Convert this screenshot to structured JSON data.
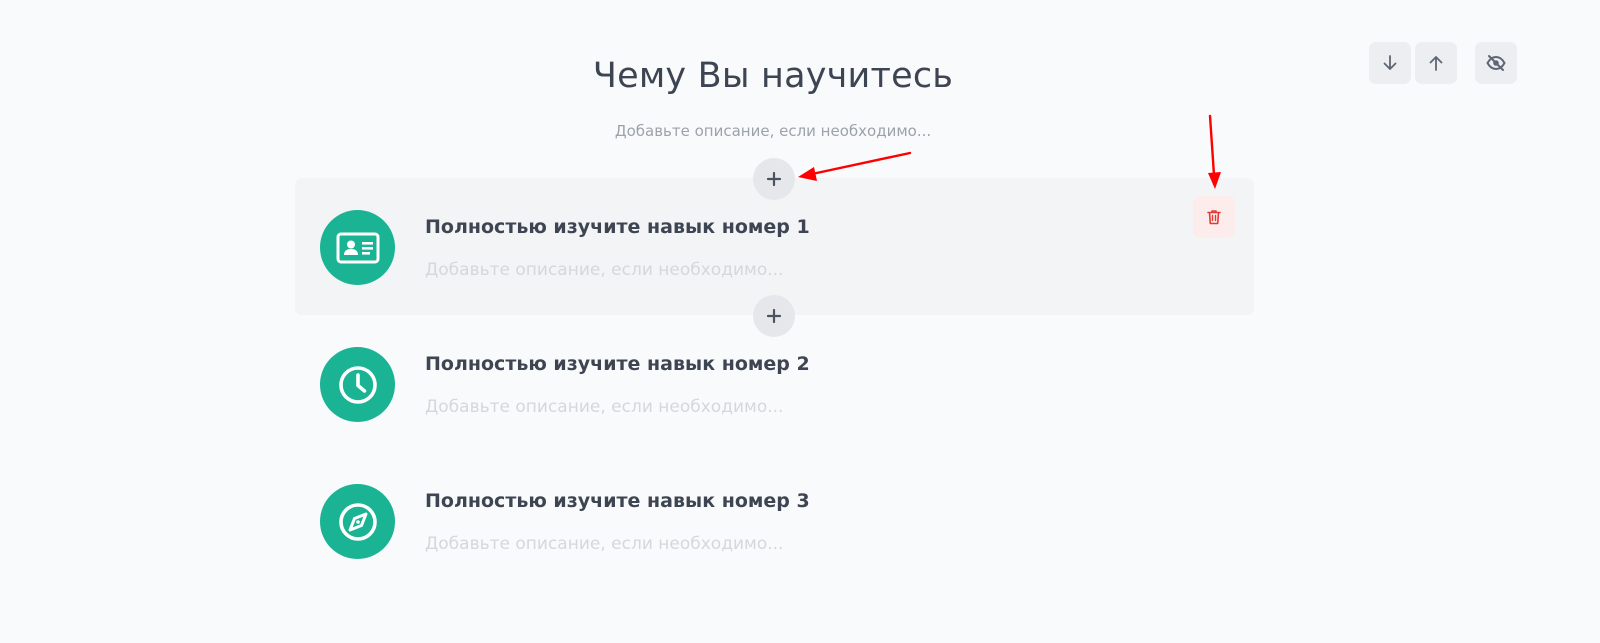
{
  "section": {
    "title": "Чему Вы научитесь",
    "description_placeholder": "Добавьте описание, если необходимо..."
  },
  "toolbar": {
    "move_down_icon": "arrow-down-icon",
    "move_up_icon": "arrow-up-icon",
    "hide_icon": "eye-off-icon"
  },
  "items": [
    {
      "title": "Полностью изучите навык номер 1",
      "description_placeholder": "Добавьте описание, если необходимо...",
      "icon": "id-card-icon",
      "active": true
    },
    {
      "title": "Полностью изучите навык номер 2",
      "description_placeholder": "Добавьте описание, если необходимо...",
      "icon": "clock-icon",
      "active": false
    },
    {
      "title": "Полностью изучите навык номер 3",
      "description_placeholder": "Добавьте описание, если необходимо...",
      "icon": "compass-icon",
      "active": false
    }
  ],
  "colors": {
    "accent": "#1ab394",
    "text": "#3e4552",
    "muted": "#9ca2ab",
    "placeholder": "#d4d7dc",
    "danger": "#e53935",
    "annotation_arrow": "#ff0000"
  }
}
